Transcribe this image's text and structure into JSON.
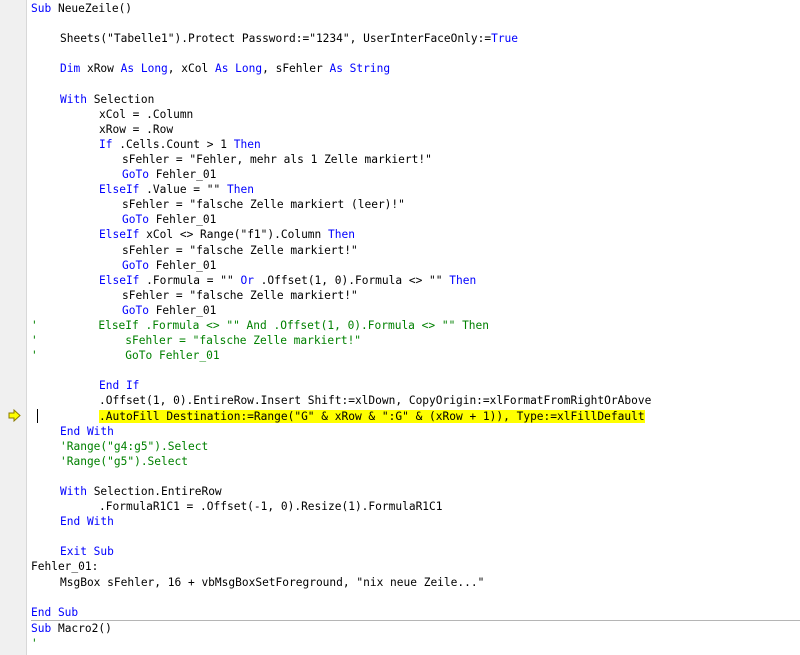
{
  "editor": {
    "colors": {
      "keyword": "#0000ff",
      "comment": "#008000",
      "highlight": "#ffff00",
      "text": "#000000"
    },
    "margin_icon": "execution-arrow-icon",
    "lines": [
      {
        "indent": 0,
        "parts": [
          {
            "t": "kw",
            "s": "Sub "
          },
          {
            "t": "tx",
            "s": "NeueZeile()"
          }
        ]
      },
      {
        "indent": 0,
        "parts": []
      },
      {
        "indent": 1,
        "parts": [
          {
            "t": "tx",
            "s": "Sheets(\"Tabelle1\").Protect Password:=\"1234\", UserInterFaceOnly:="
          },
          {
            "t": "kw",
            "s": "True"
          }
        ]
      },
      {
        "indent": 0,
        "parts": []
      },
      {
        "indent": 1,
        "parts": [
          {
            "t": "kw",
            "s": "Dim "
          },
          {
            "t": "tx",
            "s": "xRow "
          },
          {
            "t": "kw",
            "s": "As Long"
          },
          {
            "t": "tx",
            "s": ", xCol "
          },
          {
            "t": "kw",
            "s": "As Long"
          },
          {
            "t": "tx",
            "s": ", sFehler "
          },
          {
            "t": "kw",
            "s": "As String"
          }
        ]
      },
      {
        "indent": 0,
        "parts": []
      },
      {
        "indent": 1,
        "parts": [
          {
            "t": "kw",
            "s": "With "
          },
          {
            "t": "tx",
            "s": "Selection"
          }
        ]
      },
      {
        "indent": 2,
        "parts": [
          {
            "t": "tx",
            "s": "xCol = .Column"
          }
        ]
      },
      {
        "indent": 2,
        "parts": [
          {
            "t": "tx",
            "s": "xRow = .Row"
          }
        ]
      },
      {
        "indent": 2,
        "parts": [
          {
            "t": "kw",
            "s": "If "
          },
          {
            "t": "tx",
            "s": ".Cells.Count > 1 "
          },
          {
            "t": "kw",
            "s": "Then"
          }
        ]
      },
      {
        "indent": 3,
        "parts": [
          {
            "t": "tx",
            "s": "sFehler = \"Fehler, mehr als 1 Zelle markiert!\""
          }
        ]
      },
      {
        "indent": 3,
        "parts": [
          {
            "t": "kw",
            "s": "GoTo "
          },
          {
            "t": "tx",
            "s": "Fehler_01"
          }
        ]
      },
      {
        "indent": 2,
        "parts": [
          {
            "t": "kw",
            "s": "ElseIf "
          },
          {
            "t": "tx",
            "s": ".Value = \"\" "
          },
          {
            "t": "kw",
            "s": "Then"
          }
        ]
      },
      {
        "indent": 3,
        "parts": [
          {
            "t": "tx",
            "s": "sFehler = \"falsche Zelle markiert (leer)!\""
          }
        ]
      },
      {
        "indent": 3,
        "parts": [
          {
            "t": "kw",
            "s": "GoTo "
          },
          {
            "t": "tx",
            "s": "Fehler_01"
          }
        ]
      },
      {
        "indent": 2,
        "parts": [
          {
            "t": "kw",
            "s": "ElseIf "
          },
          {
            "t": "tx",
            "s": "xCol <> Range(\"f1\").Column "
          },
          {
            "t": "kw",
            "s": "Then"
          }
        ]
      },
      {
        "indent": 3,
        "parts": [
          {
            "t": "tx",
            "s": "sFehler = \"falsche Zelle markiert!\""
          }
        ]
      },
      {
        "indent": 3,
        "parts": [
          {
            "t": "kw",
            "s": "GoTo "
          },
          {
            "t": "tx",
            "s": "Fehler_01"
          }
        ]
      },
      {
        "indent": 2,
        "parts": [
          {
            "t": "kw",
            "s": "ElseIf "
          },
          {
            "t": "tx",
            "s": ".Formula = \"\" "
          },
          {
            "t": "kw",
            "s": "Or "
          },
          {
            "t": "tx",
            "s": ".Offset(1, 0).Formula <> \"\" "
          },
          {
            "t": "kw",
            "s": "Then"
          }
        ]
      },
      {
        "indent": 3,
        "parts": [
          {
            "t": "tx",
            "s": "sFehler = \"falsche Zelle markiert!\""
          }
        ]
      },
      {
        "indent": 3,
        "parts": [
          {
            "t": "kw",
            "s": "GoTo "
          },
          {
            "t": "tx",
            "s": "Fehler_01"
          }
        ]
      },
      {
        "indent": 0,
        "parts": [
          {
            "t": "cm",
            "s": "'         ElseIf .Formula <> \"\" And .Offset(1, 0).Formula <> \"\" Then"
          }
        ]
      },
      {
        "indent": 0,
        "parts": [
          {
            "t": "cm",
            "s": "'             sFehler = \"falsche Zelle markiert!\""
          }
        ]
      },
      {
        "indent": 0,
        "parts": [
          {
            "t": "cm",
            "s": "'             GoTo Fehler_01"
          }
        ]
      },
      {
        "indent": 0,
        "parts": []
      },
      {
        "indent": 2,
        "parts": [
          {
            "t": "kw",
            "s": "End If"
          }
        ]
      },
      {
        "indent": 2,
        "parts": [
          {
            "t": "tx",
            "s": ".Offset(1, 0).EntireRow.Insert Shift:=xlDown, CopyOrigin:=xlFormatFromRightOrAbove"
          }
        ]
      },
      {
        "indent": 2,
        "highlight": true,
        "parts": [
          {
            "t": "tx",
            "s": ".AutoFill Destination:=Range(\"G\" & xRow & \":G\" & (xRow + 1)), Type:=xlFillDefault"
          }
        ]
      },
      {
        "indent": 1,
        "parts": [
          {
            "t": "kw",
            "s": "End With"
          }
        ]
      },
      {
        "indent": 1,
        "parts": [
          {
            "t": "cm",
            "s": "'Range(\"g4:g5\").Select"
          }
        ]
      },
      {
        "indent": 1,
        "parts": [
          {
            "t": "cm",
            "s": "'Range(\"g5\").Select"
          }
        ]
      },
      {
        "indent": 0,
        "parts": []
      },
      {
        "indent": 1,
        "parts": [
          {
            "t": "kw",
            "s": "With "
          },
          {
            "t": "tx",
            "s": "Selection.EntireRow"
          }
        ]
      },
      {
        "indent": 2,
        "parts": [
          {
            "t": "tx",
            "s": ".FormulaR1C1 = .Offset(-1, 0).Resize(1).FormulaR1C1"
          }
        ]
      },
      {
        "indent": 1,
        "parts": [
          {
            "t": "kw",
            "s": "End With"
          }
        ]
      },
      {
        "indent": 0,
        "parts": []
      },
      {
        "indent": 1,
        "parts": [
          {
            "t": "kw",
            "s": "Exit Sub"
          }
        ]
      },
      {
        "indent": 0,
        "parts": [
          {
            "t": "tx",
            "s": "Fehler_01:"
          }
        ]
      },
      {
        "indent": 1,
        "parts": [
          {
            "t": "tx",
            "s": "MsgBox sFehler, 16 + vbMsgBoxSetForeground, \"nix neue Zeile...\""
          }
        ]
      },
      {
        "indent": 0,
        "parts": []
      },
      {
        "indent": 0,
        "separator": true,
        "parts": [
          {
            "t": "kw",
            "s": "End Sub"
          }
        ]
      },
      {
        "indent": 0,
        "parts": [
          {
            "t": "kw",
            "s": "Sub "
          },
          {
            "t": "tx",
            "s": "Macro2()"
          }
        ]
      },
      {
        "indent": 0,
        "parts": [
          {
            "t": "cm",
            "s": "'"
          }
        ]
      }
    ]
  }
}
